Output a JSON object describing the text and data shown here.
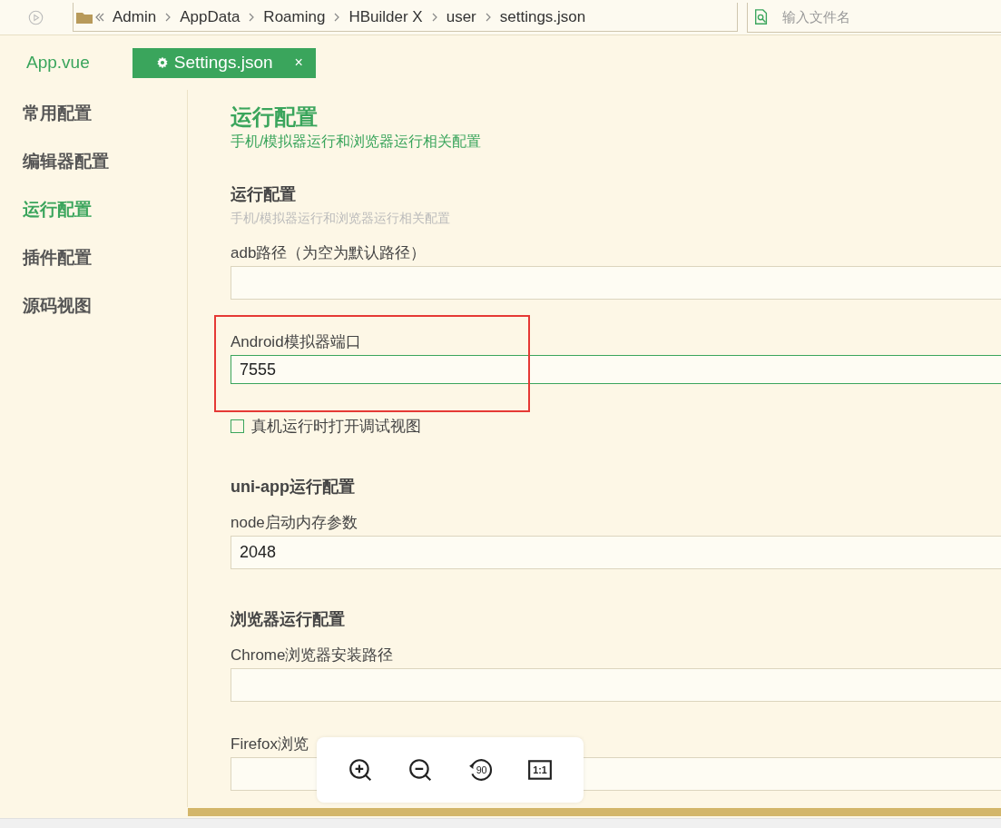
{
  "toolbar": {
    "breadcrumb": [
      "Admin",
      "AppData",
      "Roaming",
      "HBuilder X",
      "user",
      "settings.json"
    ],
    "search": {
      "placeholder": "输入文件名"
    }
  },
  "tabs": [
    {
      "label": "App.vue",
      "selected": false,
      "kind": "file"
    },
    {
      "label": "Settings.json",
      "selected": true,
      "kind": "settings",
      "close": "×"
    }
  ],
  "sidebar": {
    "items": [
      {
        "label": "常用配置",
        "selected": false
      },
      {
        "label": "编辑器配置",
        "selected": false
      },
      {
        "label": "运行配置",
        "selected": true
      },
      {
        "label": "插件配置",
        "selected": false
      },
      {
        "label": "源码视图",
        "selected": false
      }
    ]
  },
  "page": {
    "title": "运行配置",
    "subtitle": "手机/模拟器运行和浏览器运行相关配置"
  },
  "sections": [
    {
      "title": "运行配置",
      "description": "手机/模拟器运行和浏览器运行相关配置",
      "items": [
        {
          "kind": "field",
          "label": "adb路径（为空为默认路径）",
          "value": "",
          "focused": false
        },
        {
          "kind": "field",
          "label": "Android模拟器端口",
          "value": "7555",
          "focused": true,
          "highlighted": true
        },
        {
          "kind": "checkbox",
          "label": "真机运行时打开调试视图",
          "checked": false
        }
      ]
    },
    {
      "title": "uni-app运行配置",
      "items": [
        {
          "kind": "field",
          "label": "node启动内存参数",
          "value": "2048",
          "focused": false
        }
      ]
    },
    {
      "title": "浏览器运行配置",
      "items": [
        {
          "kind": "field",
          "label": "Chrome浏览器安装路径",
          "value": "",
          "focused": false
        },
        {
          "kind": "field",
          "label": "Firefox浏览",
          "value": "",
          "focused": false
        }
      ]
    }
  ],
  "viewer_toolbar": [
    {
      "kind": "zoom-in"
    },
    {
      "kind": "zoom-out"
    },
    {
      "kind": "rotate",
      "label": "90"
    },
    {
      "kind": "actual-size",
      "label": "1:1"
    }
  ]
}
